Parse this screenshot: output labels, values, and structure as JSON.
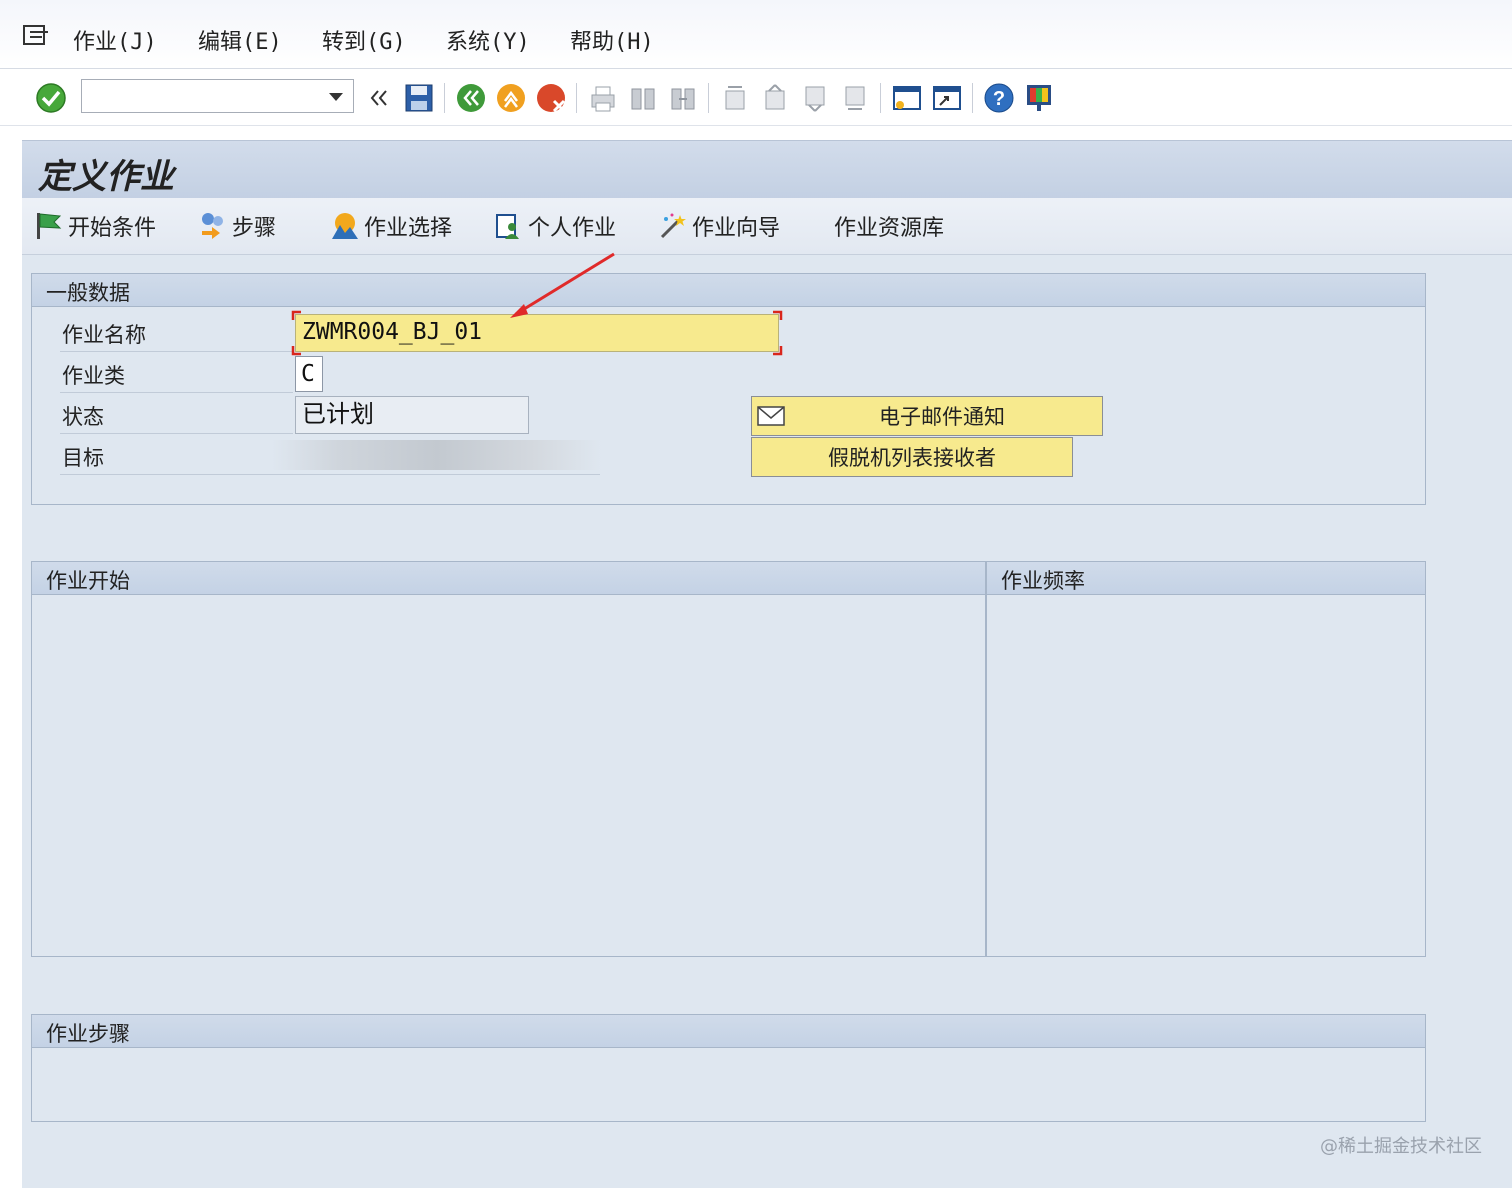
{
  "menubar": {
    "items": [
      {
        "label": "作业(J)"
      },
      {
        "label": "编辑(E)"
      },
      {
        "label": "转到(G)"
      },
      {
        "label": "系统(Y)"
      },
      {
        "label": "帮助(H)"
      }
    ]
  },
  "toolbar": {
    "command_field": {
      "value": ""
    },
    "icons": [
      "check-icon",
      "back-double-arrow-icon",
      "save-icon",
      "back-icon",
      "exit-icon",
      "cancel-icon",
      "print-icon",
      "find-icon",
      "find-next-icon",
      "first-page-icon",
      "previous-page-icon",
      "next-page-icon",
      "last-page-icon",
      "create-session-icon",
      "shortcut-icon",
      "help-icon",
      "customize-layout-icon"
    ]
  },
  "title": "定义作业",
  "app_toolbar": {
    "start_condition": "开始条件",
    "steps": "步骤",
    "job_selection": "作业选择",
    "own_jobs": "个人作业",
    "job_wizard": "作业向导",
    "job_repository": "作业资源库"
  },
  "general": {
    "header": "一般数据",
    "job_name_label": "作业名称",
    "job_name_value": "ZWMR004_BJ_01",
    "job_class_label": "作业类",
    "job_class_value": "C",
    "status_label": "状态",
    "status_value": "已计划",
    "target_label": "目标",
    "email_button": "电子邮件通知",
    "spool_button": "假脱机列表接收者"
  },
  "job_start": {
    "header": "作业开始"
  },
  "job_frequency": {
    "header": "作业频率"
  },
  "job_steps": {
    "header": "作业步骤"
  },
  "watermark": "@稀土掘金技术社区",
  "colors": {
    "input_highlight": "#f7ea8e",
    "required_marker": "#d9261c",
    "annotation_arrow": "#e02a2a"
  }
}
